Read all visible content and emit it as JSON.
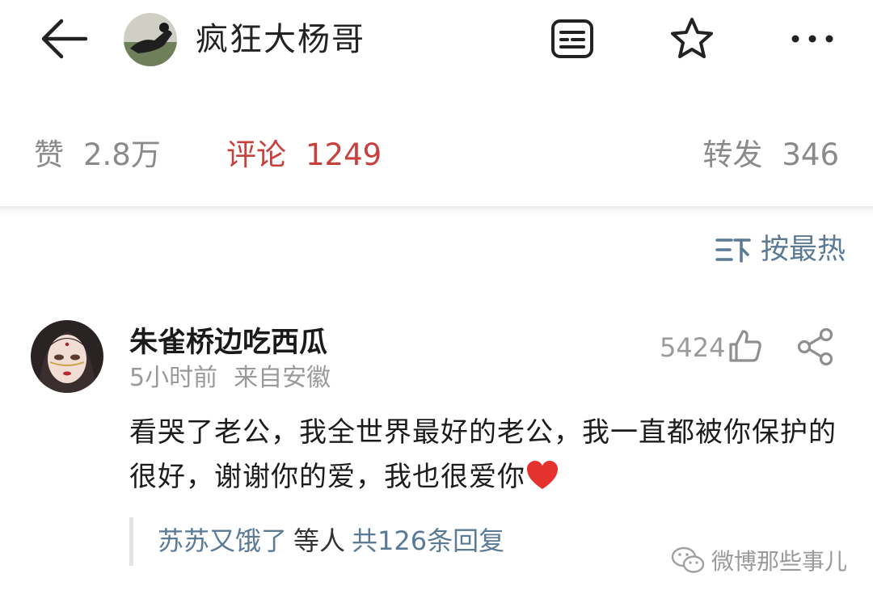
{
  "header": {
    "title": "疯狂大杨哥",
    "icons": {
      "back": "back-arrow-icon",
      "article": "article-icon",
      "star": "star-icon",
      "more": "more-icon"
    }
  },
  "stats": {
    "likes_label": "赞",
    "likes_value": "2.8万",
    "comments_label": "评论",
    "comments_value": "1249",
    "reposts_label": "转发",
    "reposts_value": "346"
  },
  "sort": {
    "label": "按最热"
  },
  "comment": {
    "username": "朱雀桥边吃西瓜",
    "time": "5小时前",
    "location": "来自安徽",
    "likes": "5424",
    "text": "看哭了老公，我全世界最好的老公，我一直都被你保护的很好，谢谢你的爱，我也很爱你",
    "replies": {
      "user": "苏苏又饿了",
      "etc": "等人",
      "count": "共126条回复"
    }
  },
  "watermark": {
    "text": "微博那些事儿"
  },
  "colors": {
    "accent_red": "#c8403e",
    "link_blue": "#5a7a96",
    "muted": "#8a8a8a"
  }
}
